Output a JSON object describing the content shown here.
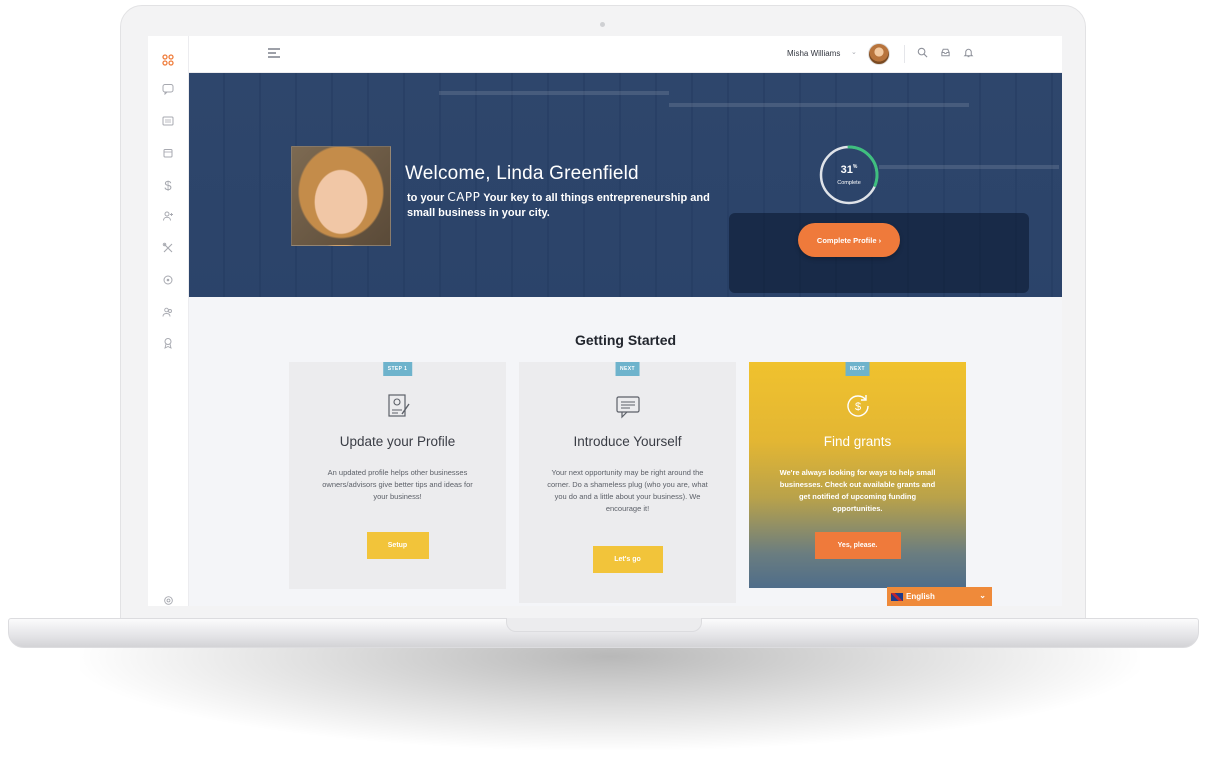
{
  "topbar": {
    "user_name": "Misha Williams",
    "user_caret": "⌄"
  },
  "sidebar": {
    "items": [
      "dashboard-icon",
      "messages-icon",
      "news-icon",
      "calendar-icon",
      "dollar-icon",
      "add-user-icon",
      "tools-icon",
      "ideas-icon",
      "community-icon",
      "awards-icon",
      "settings-icon"
    ],
    "dollar_glyph": "$"
  },
  "hero": {
    "title": "Welcome, Linda Greenfield",
    "subtitle_prefix": "to your ",
    "brand": "CAPP",
    "subtitle_rest": " Your key to all things entrepreneurship and small business in your city.",
    "progress_value": "31",
    "progress_unit": "%",
    "progress_percent": 31,
    "progress_label": "Complete",
    "complete_button": "Complete Profile  ›"
  },
  "getting_started": {
    "title": "Getting Started",
    "cards": [
      {
        "tag": "STEP 1",
        "title": "Update your Profile",
        "description": "An updated profile helps other businesses owners/advisors give better tips and ideas for your business!",
        "button": "Setup",
        "icon": "profile-document-icon"
      },
      {
        "tag": "NEXT",
        "title": "Introduce Yourself",
        "description": "Your next opportunity may be right around the corner. Do a shameless plug (who you are, what you do and a little about your business). We encourage it!",
        "button": "Let's go",
        "icon": "chat-bubble-icon"
      },
      {
        "tag": "NEXT",
        "title": "Find grants",
        "description": "We're always looking for ways to help small businesses. Check out available grants and get notified of upcoming funding opportunities.",
        "button": "Yes, please.",
        "icon": "dollar-refresh-icon"
      }
    ]
  },
  "language": {
    "selected": "English",
    "caret": "⌄"
  },
  "colors": {
    "accent_orange": "#ef7a3b",
    "accent_yellow": "#f2c43a",
    "hero_blue": "#1c3660",
    "tag_blue": "#6eb3cc",
    "progress_green": "#3fbf7f"
  }
}
